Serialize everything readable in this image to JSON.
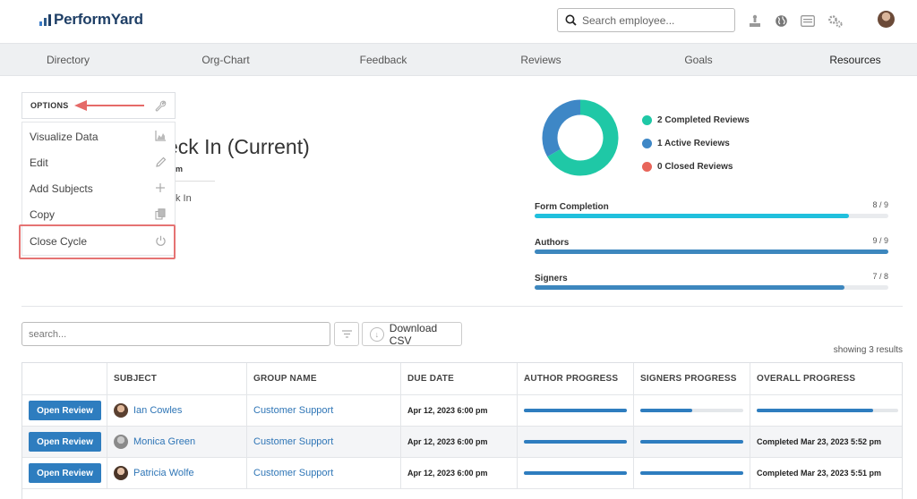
{
  "header": {
    "logo_text": "PerformYard",
    "search_placeholder": "Search employee...",
    "icons": [
      "org-icon",
      "globe-icon",
      "id-card-icon",
      "gears-icon"
    ]
  },
  "nav": {
    "items": [
      {
        "label": "Directory"
      },
      {
        "label": "Org-Chart"
      },
      {
        "label": "Feedback"
      },
      {
        "label": "Reviews"
      },
      {
        "label": "Goals"
      },
      {
        "label": "Resources"
      }
    ]
  },
  "options": {
    "header": "OPTIONS",
    "items": [
      {
        "label": "Visualize Data",
        "icon": "chart-icon"
      },
      {
        "label": "Edit",
        "icon": "pencil-icon"
      },
      {
        "label": "Add Subjects",
        "icon": "plus-icon"
      },
      {
        "label": "Copy",
        "icon": "copy-icon"
      },
      {
        "label": "Close Cycle",
        "icon": "power-icon"
      }
    ]
  },
  "cycle": {
    "title_visible": "eck In (Current)",
    "subtitle_visible": "m",
    "form_visible": "k In"
  },
  "summary": {
    "legend": [
      {
        "label": "2 Completed Reviews",
        "value": 2,
        "color": "#1fc8a6"
      },
      {
        "label": "1 Active Reviews",
        "value": 1,
        "color": "#3e87c6"
      },
      {
        "label": "0 Closed Reviews",
        "value": 0,
        "color": "#e8655a"
      }
    ],
    "progress": [
      {
        "label": "Form Completion",
        "count": "8 / 9",
        "fraction": 0.8889,
        "color": "#20c0dd"
      },
      {
        "label": "Authors",
        "count": "9 / 9",
        "fraction": 1.0,
        "color": "#3d87be"
      },
      {
        "label": "Signers",
        "count": "7 / 8",
        "fraction": 0.875,
        "color": "#3d87be"
      }
    ]
  },
  "table_tools": {
    "search_placeholder": "search...",
    "download_label": "Download CSV",
    "results_text": "showing 3 results"
  },
  "table": {
    "columns": [
      "SUBJECT",
      "GROUP NAME",
      "DUE DATE",
      "AUTHOR PROGRESS",
      "SIGNERS PROGRESS",
      "OVERALL PROGRESS"
    ],
    "open_label": "Open Review",
    "rows": [
      {
        "subject": "Ian Cowles",
        "group": "Customer Support",
        "due": "Apr 12, 2023 6:00 pm",
        "author_progress": 1.0,
        "signers_progress": 0.5,
        "overall_progress": 0.82,
        "overall_text": ""
      },
      {
        "subject": "Monica Green",
        "group": "Customer Support",
        "due": "Apr 12, 2023 6:00 pm",
        "author_progress": 1.0,
        "signers_progress": 1.0,
        "overall_progress": 1.0,
        "overall_text": "Completed Mar 23, 2023 5:52 pm"
      },
      {
        "subject": "Patricia Wolfe",
        "group": "Customer Support",
        "due": "Apr 12, 2023 6:00 pm",
        "author_progress": 1.0,
        "signers_progress": 1.0,
        "overall_progress": 1.0,
        "overall_text": "Completed Mar 23, 2023 5:51 pm"
      }
    ]
  }
}
